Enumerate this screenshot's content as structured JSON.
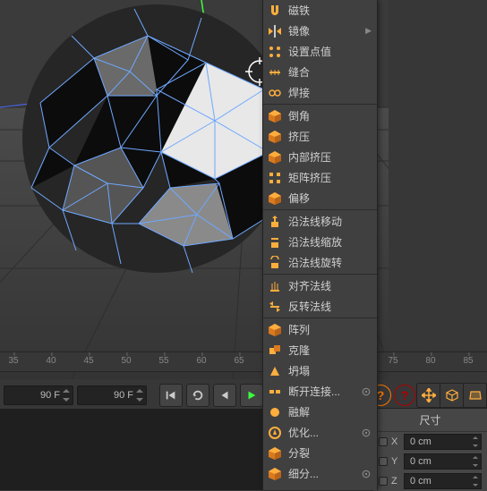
{
  "timeline": {
    "ticks": [
      {
        "pos": 15,
        "label": "35"
      },
      {
        "pos": 57,
        "label": "40"
      },
      {
        "pos": 99,
        "label": "45"
      },
      {
        "pos": 141,
        "label": "50"
      },
      {
        "pos": 183,
        "label": "55"
      },
      {
        "pos": 225,
        "label": "60"
      },
      {
        "pos": 267,
        "label": "65"
      },
      {
        "pos": 439,
        "label": "75"
      },
      {
        "pos": 481,
        "label": "80"
      },
      {
        "pos": 523,
        "label": "85"
      }
    ],
    "frame_start": "90 F",
    "frame_end": "90 F"
  },
  "attrs": {
    "title": "尺寸",
    "x_label": "X",
    "x_val": "0 cm",
    "y_label": "Y",
    "y_val": "0 cm",
    "z_label": "Z",
    "z_val": "0 cm"
  },
  "menu": {
    "items": [
      {
        "icon": "magnet",
        "label": "磁铁",
        "sub": false
      },
      {
        "icon": "mirror",
        "label": "镜像",
        "sub": true
      },
      {
        "icon": "setpoint",
        "label": "设置点值",
        "sub": false
      },
      {
        "icon": "stitch",
        "label": "缝合",
        "sub": false
      },
      {
        "icon": "weld",
        "label": "焊接",
        "sub": false
      },
      {
        "sep": true
      },
      {
        "icon": "bevel",
        "label": "倒角",
        "sub": false
      },
      {
        "icon": "extrude",
        "label": "挤压",
        "sub": false
      },
      {
        "icon": "inner",
        "label": "内部挤压",
        "sub": false
      },
      {
        "icon": "matrix",
        "label": "矩阵挤压",
        "sub": false
      },
      {
        "icon": "offset",
        "label": "偏移",
        "sub": false
      },
      {
        "sep": true
      },
      {
        "icon": "nmove",
        "label": "沿法线移动",
        "sub": false
      },
      {
        "icon": "nscale",
        "label": "沿法线缩放",
        "sub": false
      },
      {
        "icon": "nrot",
        "label": "沿法线旋转",
        "sub": false
      },
      {
        "sep": true
      },
      {
        "icon": "align",
        "label": "对齐法线",
        "sub": false
      },
      {
        "icon": "flip",
        "label": "反转法线",
        "sub": false
      },
      {
        "sep": true
      },
      {
        "icon": "array",
        "label": "阵列",
        "sub": false
      },
      {
        "icon": "clone",
        "label": "克隆",
        "sub": false
      },
      {
        "icon": "collapse",
        "label": "坍塌",
        "sub": false
      },
      {
        "icon": "disconnect",
        "label": "断开连接...",
        "sub": false,
        "gear": true
      },
      {
        "icon": "melt",
        "label": "融解",
        "sub": false
      },
      {
        "icon": "optimize",
        "label": "优化...",
        "sub": false,
        "gear": true
      },
      {
        "icon": "split",
        "label": "分裂",
        "sub": false
      },
      {
        "icon": "subdivide",
        "label": "细分...",
        "sub": false,
        "gear": true
      }
    ]
  }
}
